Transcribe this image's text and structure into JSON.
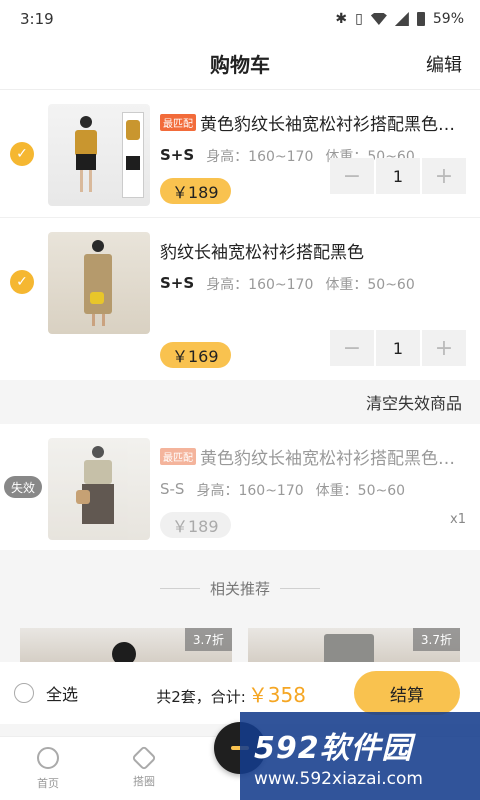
{
  "status_bar": {
    "time": "3:19",
    "battery": "59%"
  },
  "nav": {
    "title": "购物车",
    "edit_label": "编辑"
  },
  "items": [
    {
      "badge": "最匹配",
      "title": "黄色豹纹长袖宽松衬衫搭配黑色…",
      "size": "S+S",
      "height": "身高：160~170",
      "weight": "体重：50~60",
      "price": "￥189",
      "qty": "1",
      "checked": true
    },
    {
      "title": "豹纹长袖宽松衬衫搭配黑色",
      "size": "S+S",
      "height": "身高：160~170",
      "weight": "体重：50~60",
      "price": "￥169",
      "qty": "1",
      "checked": true
    }
  ],
  "clear_label": "清空失效商品",
  "invalid_item": {
    "tag": "失效",
    "badge": "最匹配",
    "title": "黄色豹纹长袖宽松衬衫搭配黑色…",
    "size": "S-S",
    "height": "身高：160~170",
    "weight": "体重：50~60",
    "price": "￥189",
    "qty": "x1"
  },
  "recommend": {
    "title": "相关推荐",
    "cards": [
      {
        "discount": "3.7折"
      },
      {
        "discount": "3.7折"
      }
    ]
  },
  "bottom": {
    "select_all": "全选",
    "total_prefix": "共2套，合计:",
    "total_amount": "￥358",
    "checkout": "结算"
  },
  "tabs": [
    {
      "label": "首页"
    },
    {
      "label": "搭圈"
    }
  ],
  "watermark": {
    "logo": "592软件园",
    "url": "www.592xiazai.com"
  },
  "colors": {
    "accent": "#f9c24f",
    "badge": "#f26b3a",
    "price_total": "#f5a623"
  }
}
